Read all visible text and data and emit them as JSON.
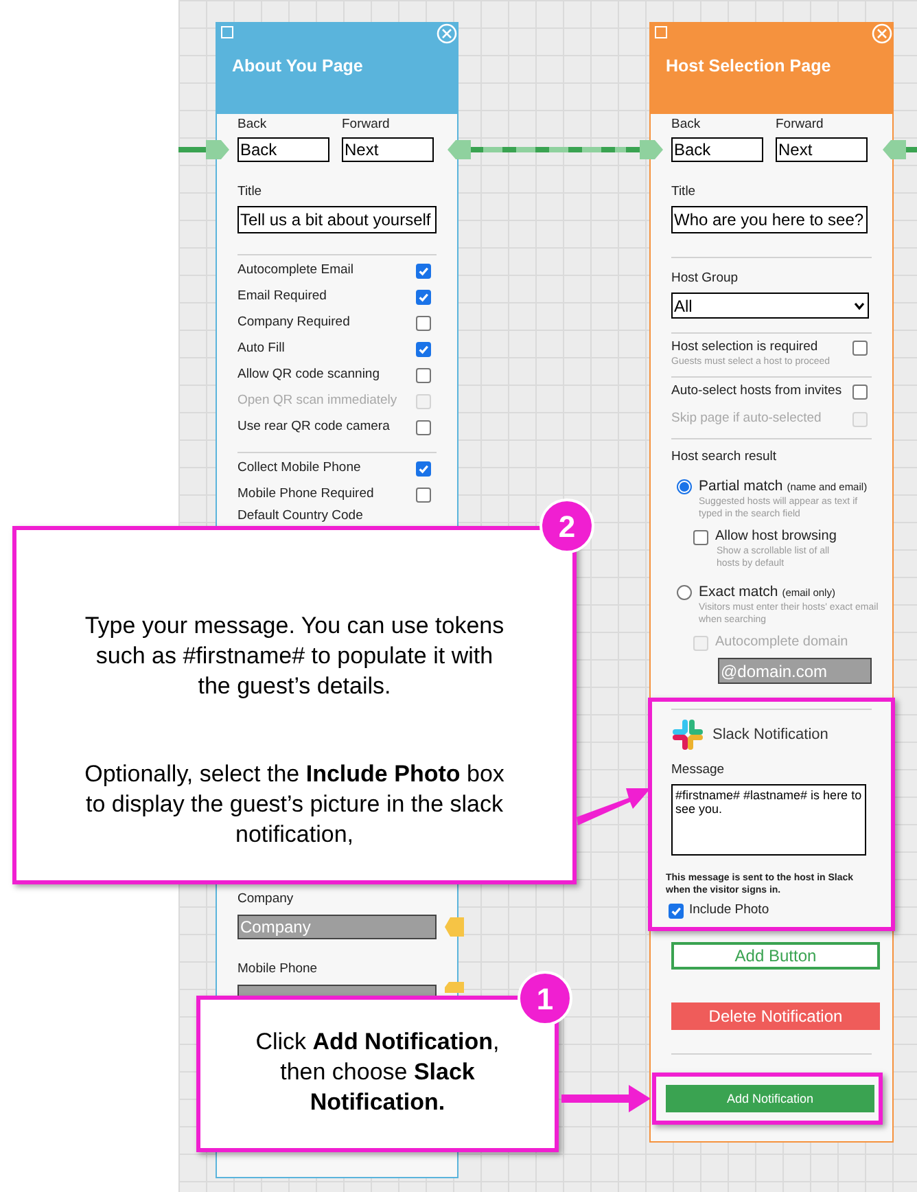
{
  "about_you_page": {
    "title": "About You Page",
    "nav": [
      {
        "label": "Back",
        "value": "Back"
      },
      {
        "label": "Forward",
        "value": "Next"
      }
    ],
    "title_field": {
      "label": "Title",
      "value": "Tell us a bit about yourself"
    },
    "option_groups": [
      [
        {
          "label": "Autocomplete Email",
          "checked": true,
          "disabled": false
        },
        {
          "label": "Email Required",
          "checked": true,
          "disabled": false
        },
        {
          "label": "Company Required",
          "checked": false,
          "disabled": false
        },
        {
          "label": "Auto Fill",
          "checked": true,
          "disabled": false
        },
        {
          "label": "Allow QR code scanning",
          "checked": false,
          "disabled": false
        },
        {
          "label": "Open QR scan immediately",
          "checked": false,
          "disabled": true
        },
        {
          "label": "Use rear QR code camera",
          "checked": false,
          "disabled": false
        }
      ],
      [
        {
          "label": "Collect Mobile Phone",
          "checked": true,
          "disabled": false
        },
        {
          "label": "Mobile Phone Required",
          "checked": false,
          "disabled": false
        }
      ]
    ],
    "default_country_code_label": "Default Country Code",
    "fields": [
      {
        "label": "Company",
        "placeholder": "Company"
      },
      {
        "label": "Mobile Phone"
      }
    ]
  },
  "host_selection_page": {
    "title": "Host Selection Page",
    "nav": [
      {
        "label": "Back",
        "value": "Back"
      },
      {
        "label": "Forward",
        "value": "Next"
      }
    ],
    "title_field": {
      "label": "Title",
      "value": "Who are you here to see?"
    },
    "host_group": {
      "label": "Host Group",
      "value": "All"
    },
    "settings": [
      [
        {
          "label": "Host selection is required",
          "hint": "Guests must select a host to proceed",
          "checked": false,
          "disabled": false
        }
      ],
      [
        {
          "label": "Auto-select hosts from invites",
          "checked": false,
          "disabled": false
        },
        {
          "label": "Skip page if auto-selected",
          "checked": false,
          "disabled": true
        }
      ]
    ],
    "host_search": {
      "label": "Host search result",
      "options": [
        {
          "label": "Partial match",
          "note": "(name and email)",
          "hint": "Suggested hosts will appear as text if typed in the search field",
          "selected": true,
          "sub_option": {
            "label": "Allow host browsing",
            "hint": "Show a scrollable list of all hosts by default",
            "checked": false,
            "disabled": false
          }
        },
        {
          "label": "Exact match",
          "note": "(email only)",
          "hint": "Visitors must enter their hosts' exact email when searching",
          "selected": false,
          "sub_option": {
            "label": "Autocomplete domain",
            "checked": false,
            "disabled": true
          },
          "domain_field": {
            "placeholder": "@domain.com"
          }
        }
      ]
    },
    "slack_notification": {
      "title": "Slack Notification",
      "message_label": "Message",
      "message": "#firstname# #lastname# is here to see you.",
      "note": "This message is sent to the host in Slack when the visitor signs in.",
      "include_photo": {
        "label": "Include Photo",
        "checked": true
      }
    },
    "buttons": [
      {
        "kind": "outline",
        "label": "Add Button"
      },
      {
        "kind": "danger",
        "label": "Delete Notification"
      }
    ],
    "add_notification_button": "Add Notification"
  },
  "callouts": [
    {
      "number": "2",
      "paragraphs": [
        "Type your message. You can use tokens such as #firstname# to populate it with the guest’s details.",
        "Optionally, select the **Include Photo** box to display the guest’s picture in the slack notification,"
      ]
    },
    {
      "number": "1",
      "paragraphs": [
        "Click **Add Notification**, then choose **Slack Notification.**"
      ]
    }
  ]
}
